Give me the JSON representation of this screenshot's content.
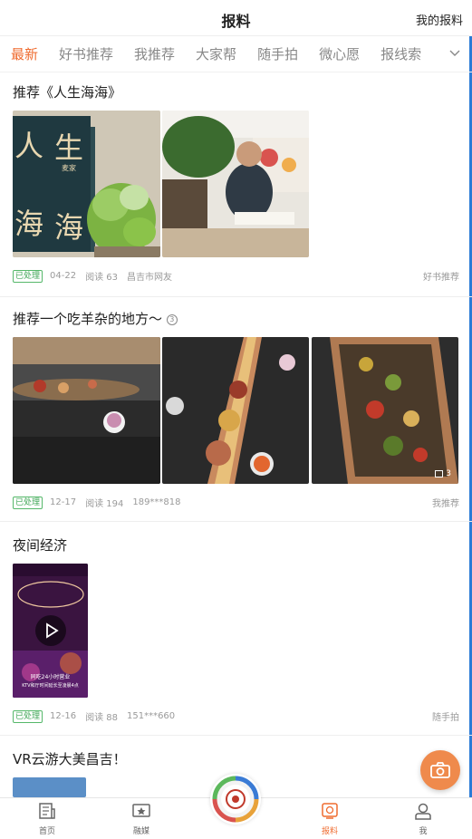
{
  "header": {
    "title": "报料",
    "right_link": "我的报料"
  },
  "tabs": [
    "最新",
    "好书推荐",
    "我推荐",
    "大家帮",
    "随手拍",
    "微心愿",
    "报线索"
  ],
  "posts": [
    {
      "title": "推荐《人生海海》",
      "status": "已处理",
      "date": "04-22",
      "reads": "阅读 63",
      "author": "昌吉市网友",
      "category": "好书推荐"
    },
    {
      "title": "推荐一个吃羊杂的地方～",
      "status": "已处理",
      "date": "12-17",
      "reads": "阅读 194",
      "author": "189***818",
      "category": "我推荐",
      "image_count": "3"
    },
    {
      "title": "夜间经济",
      "status": "已处理",
      "date": "12-16",
      "reads": "阅读 88",
      "author": "151***660",
      "category": "随手拍"
    },
    {
      "title": "VR云游大美昌吉！"
    }
  ],
  "book_cover": {
    "big_chars": [
      "人",
      "生",
      "海",
      "海"
    ],
    "author": "麦家"
  },
  "video_thumb": {
    "line1": "同吃24小时营业",
    "line2": "KTV和厅时间延长至凌晨4点"
  },
  "bottom_nav": [
    "首页",
    "融媒",
    "报料",
    "我"
  ],
  "colors": {
    "accent": "#ef6b2f",
    "status": "#3fa656",
    "fab": "#ef8a4c"
  }
}
